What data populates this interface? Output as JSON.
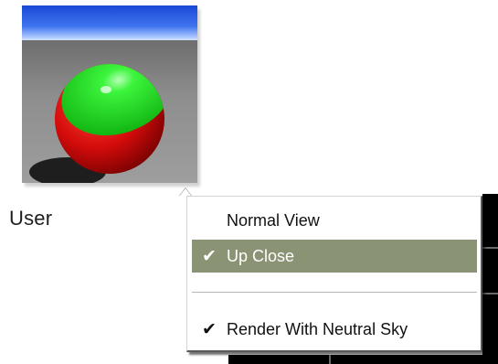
{
  "swatch": {
    "label": "User",
    "preview_colors": {
      "sky_top": "#1f4fd8",
      "horizon": "#a9c9ff",
      "floor": "#8c8c8c",
      "sphere_green": "#19e019",
      "sphere_red": "#e01010"
    }
  },
  "context_menu": {
    "items": [
      {
        "label": "Normal View",
        "checked": "",
        "highlighted": false
      },
      {
        "label": "Up Close",
        "checked": "✔",
        "highlighted": true
      },
      {
        "label": "Render With Neutral Sky",
        "checked": "✔",
        "highlighted": false
      }
    ],
    "colors": {
      "highlight": "#8a9474",
      "background": "#ffffff"
    }
  }
}
